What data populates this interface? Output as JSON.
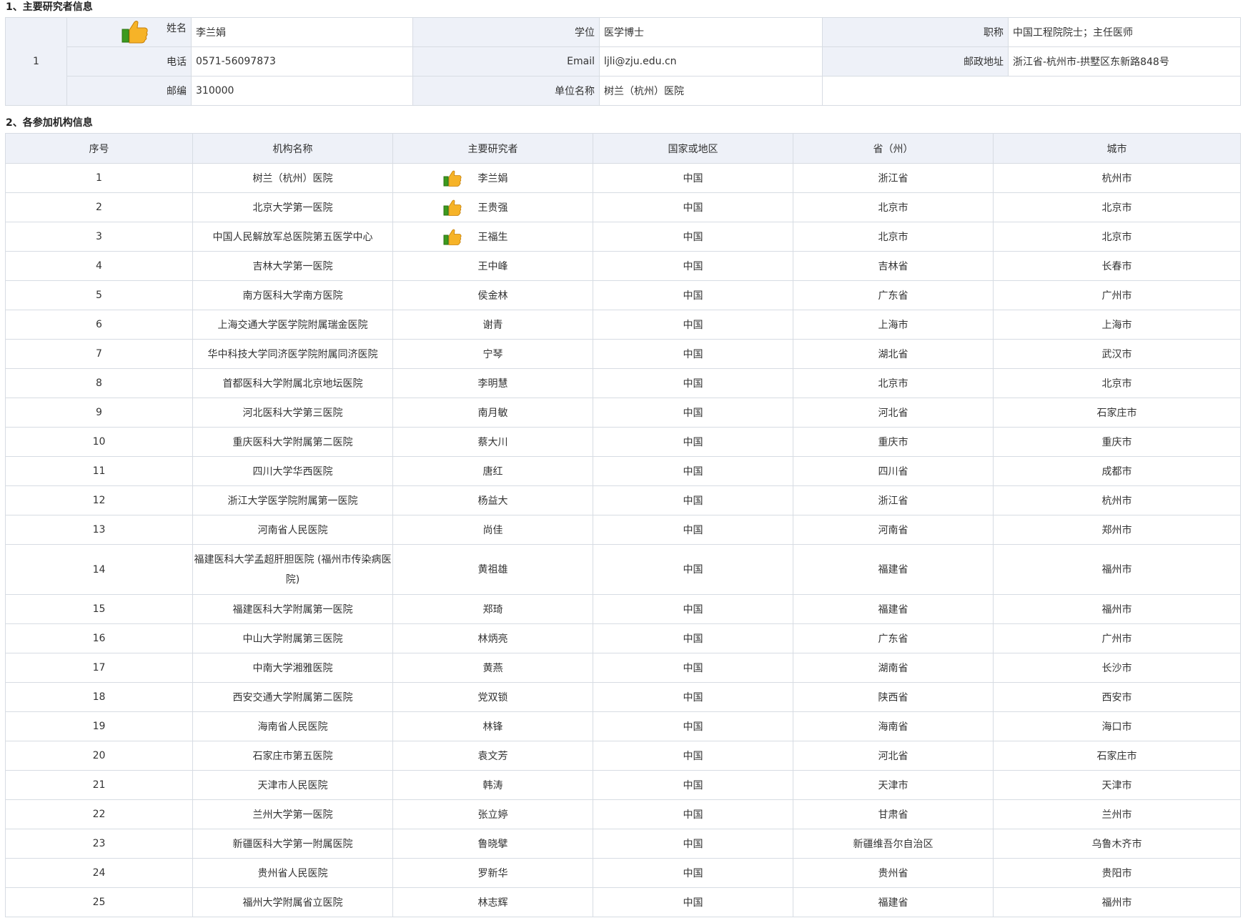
{
  "sections": {
    "investigator_title": "1、主要研究者信息",
    "sites_title": "2、各参加机构信息"
  },
  "investigator": {
    "index": "1",
    "name_label": "姓名",
    "name": "李兰娟",
    "degree_label": "学位",
    "degree": "医学博士",
    "title_label": "职称",
    "title": "中国工程院院士；主任医师",
    "phone_label": "电话",
    "phone": "0571-56097873",
    "email_label": "Email",
    "email": "ljli@zju.edu.cn",
    "address_label": "邮政地址",
    "address": "浙江省-杭州市-拱墅区东新路848号",
    "zip_label": "邮编",
    "zip": "310000",
    "org_label": "单位名称",
    "org": "树兰（杭州）医院"
  },
  "sites_table": {
    "headers": [
      "序号",
      "机构名称",
      "主要研究者",
      "国家或地区",
      "省（州）",
      "城市"
    ],
    "rows": [
      {
        "no": "1",
        "org": "树兰（杭州）医院",
        "pi": "李兰娟",
        "country": "中国",
        "province": "浙江省",
        "city": "杭州市",
        "lead": true
      },
      {
        "no": "2",
        "org": "北京大学第一医院",
        "pi": "王贵强",
        "country": "中国",
        "province": "北京市",
        "city": "北京市",
        "lead": true
      },
      {
        "no": "3",
        "org": "中国人民解放军总医院第五医学中心",
        "pi": "王福生",
        "country": "中国",
        "province": "北京市",
        "city": "北京市",
        "lead": true
      },
      {
        "no": "4",
        "org": "吉林大学第一医院",
        "pi": "王中峰",
        "country": "中国",
        "province": "吉林省",
        "city": "长春市"
      },
      {
        "no": "5",
        "org": "南方医科大学南方医院",
        "pi": "侯金林",
        "country": "中国",
        "province": "广东省",
        "city": "广州市"
      },
      {
        "no": "6",
        "org": "上海交通大学医学院附属瑞金医院",
        "pi": "谢青",
        "country": "中国",
        "province": "上海市",
        "city": "上海市"
      },
      {
        "no": "7",
        "org": "华中科技大学同济医学院附属同济医院",
        "pi": "宁琴",
        "country": "中国",
        "province": "湖北省",
        "city": "武汉市"
      },
      {
        "no": "8",
        "org": "首都医科大学附属北京地坛医院",
        "pi": "李明慧",
        "country": "中国",
        "province": "北京市",
        "city": "北京市"
      },
      {
        "no": "9",
        "org": "河北医科大学第三医院",
        "pi": "南月敏",
        "country": "中国",
        "province": "河北省",
        "city": "石家庄市"
      },
      {
        "no": "10",
        "org": "重庆医科大学附属第二医院",
        "pi": "蔡大川",
        "country": "中国",
        "province": "重庆市",
        "city": "重庆市"
      },
      {
        "no": "11",
        "org": "四川大学华西医院",
        "pi": "唐红",
        "country": "中国",
        "province": "四川省",
        "city": "成都市"
      },
      {
        "no": "12",
        "org": "浙江大学医学院附属第一医院",
        "pi": "杨益大",
        "country": "中国",
        "province": "浙江省",
        "city": "杭州市"
      },
      {
        "no": "13",
        "org": "河南省人民医院",
        "pi": "尚佳",
        "country": "中国",
        "province": "河南省",
        "city": "郑州市"
      },
      {
        "no": "14",
        "org": "福建医科大学孟超肝胆医院 (福州市传染病医院)",
        "pi": "黄祖雄",
        "country": "中国",
        "province": "福建省",
        "city": "福州市",
        "tall": true
      },
      {
        "no": "15",
        "org": "福建医科大学附属第一医院",
        "pi": "郑琦",
        "country": "中国",
        "province": "福建省",
        "city": "福州市"
      },
      {
        "no": "16",
        "org": "中山大学附属第三医院",
        "pi": "林炳亮",
        "country": "中国",
        "province": "广东省",
        "city": "广州市"
      },
      {
        "no": "17",
        "org": "中南大学湘雅医院",
        "pi": "黄燕",
        "country": "中国",
        "province": "湖南省",
        "city": "长沙市"
      },
      {
        "no": "18",
        "org": "西安交通大学附属第二医院",
        "pi": "党双锁",
        "country": "中国",
        "province": "陕西省",
        "city": "西安市"
      },
      {
        "no": "19",
        "org": "海南省人民医院",
        "pi": "林锋",
        "country": "中国",
        "province": "海南省",
        "city": "海口市"
      },
      {
        "no": "20",
        "org": "石家庄市第五医院",
        "pi": "袁文芳",
        "country": "中国",
        "province": "河北省",
        "city": "石家庄市"
      },
      {
        "no": "21",
        "org": "天津市人民医院",
        "pi": "韩涛",
        "country": "中国",
        "province": "天津市",
        "city": "天津市"
      },
      {
        "no": "22",
        "org": "兰州大学第一医院",
        "pi": "张立婷",
        "country": "中国",
        "province": "甘肃省",
        "city": "兰州市"
      },
      {
        "no": "23",
        "org": "新疆医科大学第一附属医院",
        "pi": "鲁晓擘",
        "country": "中国",
        "province": "新疆维吾尔自治区",
        "city": "乌鲁木齐市"
      },
      {
        "no": "24",
        "org": "贵州省人民医院",
        "pi": "罗新华",
        "country": "中国",
        "province": "贵州省",
        "city": "贵阳市"
      },
      {
        "no": "25",
        "org": "福州大学附属省立医院",
        "pi": "林志辉",
        "country": "中国",
        "province": "福建省",
        "city": "福州市"
      }
    ]
  },
  "icons": {
    "lead_investigator": "thumbs-up-icon"
  }
}
